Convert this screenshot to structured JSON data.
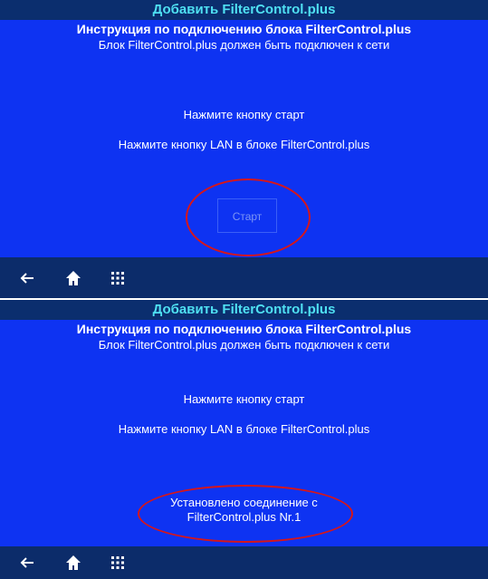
{
  "panels": [
    {
      "title": "Добавить FilterControl.plus",
      "heading": "Инструкция по подключению блока FilterControl.plus",
      "subheading": "Блок FilterControl.plus должен быть подключен к сети",
      "instruction1": "Нажмите кнопку старт",
      "instruction2": "Нажмите кнопку LAN в блоке FilterControl.plus",
      "start_label": "Старт"
    },
    {
      "title": "Добавить FilterControl.plus",
      "heading": "Инструкция по подключению блока FilterControl.plus",
      "subheading": "Блок FilterControl.plus должен быть подключен к сети",
      "instruction1": "Нажмите кнопку старт",
      "instruction2": "Нажмите кнопку LAN в блоке FilterControl.plus",
      "status_line1": "Установлено соединение с",
      "status_line2": "FilterControl.plus Nr.1"
    }
  ],
  "nav_icons": [
    "back-arrow-icon",
    "home-icon",
    "grid-menu-icon"
  ],
  "colors": {
    "content_bg": "#0e33f2",
    "titlebar_bg": "#0b2e6e",
    "title_text": "#4fe0f2",
    "highlight_ellipse": "#d6161a"
  }
}
